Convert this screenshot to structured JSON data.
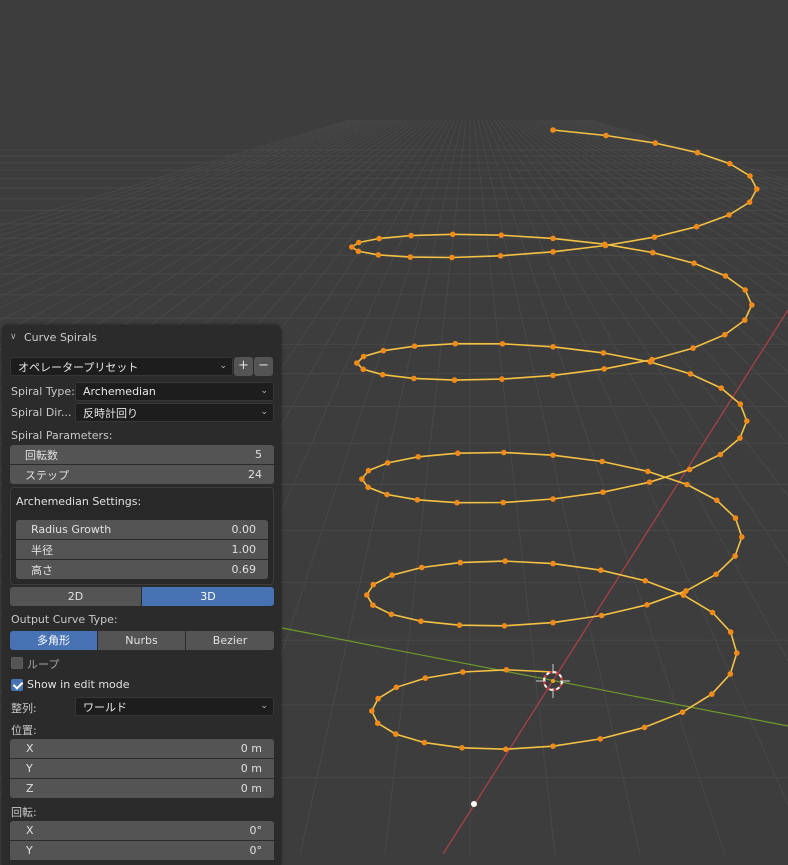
{
  "panel": {
    "title": "Curve Spirals",
    "preset": {
      "value": "オペレータープリセット",
      "add": "+",
      "remove": "−"
    },
    "spiral_type": {
      "label": "Spiral Type:",
      "value": "Archemedian"
    },
    "spiral_direction": {
      "label": "Spiral Dir...",
      "value": "反時計回り"
    },
    "spiral_parameters": {
      "label": "Spiral Parameters:",
      "turns": {
        "label": "回転数",
        "value": "5"
      },
      "steps": {
        "label": "ステップ",
        "value": "24"
      }
    },
    "archemedian": {
      "label": "Archemedian Settings:",
      "radius_growth": {
        "label": "Radius Growth",
        "value": "0.00"
      },
      "radius": {
        "label": "半径",
        "value": "1.00"
      },
      "height": {
        "label": "高さ",
        "value": "0.69"
      }
    },
    "dimension": {
      "options": [
        "2D",
        "3D"
      ],
      "selected": "3D"
    },
    "output_curve_type": {
      "label": "Output Curve Type:",
      "options": [
        "多角形",
        "Nurbs",
        "Bezier"
      ],
      "selected": "多角形"
    },
    "loop": {
      "label": "ループ",
      "checked": false
    },
    "show_in_edit_mode": {
      "label": "Show in edit mode",
      "checked": true
    },
    "align": {
      "label": "整列:",
      "value": "ワールド"
    },
    "location": {
      "label": "位置:",
      "x": {
        "label": "X",
        "value": "0 m"
      },
      "y": {
        "label": "Y",
        "value": "0 m"
      },
      "z": {
        "label": "Z",
        "value": "0 m"
      }
    },
    "rotation": {
      "label": "回転:",
      "x": {
        "label": "X",
        "value": "0°"
      },
      "y": {
        "label": "Y",
        "value": "0°"
      }
    }
  },
  "viewport": {
    "colors": {
      "background": "#3d3d3d",
      "grid": "#484848",
      "x_axis": "#b0404a",
      "y_axis": "#6e9a2a",
      "curve": "#f4c243",
      "vertex": "#f08a18"
    }
  }
}
